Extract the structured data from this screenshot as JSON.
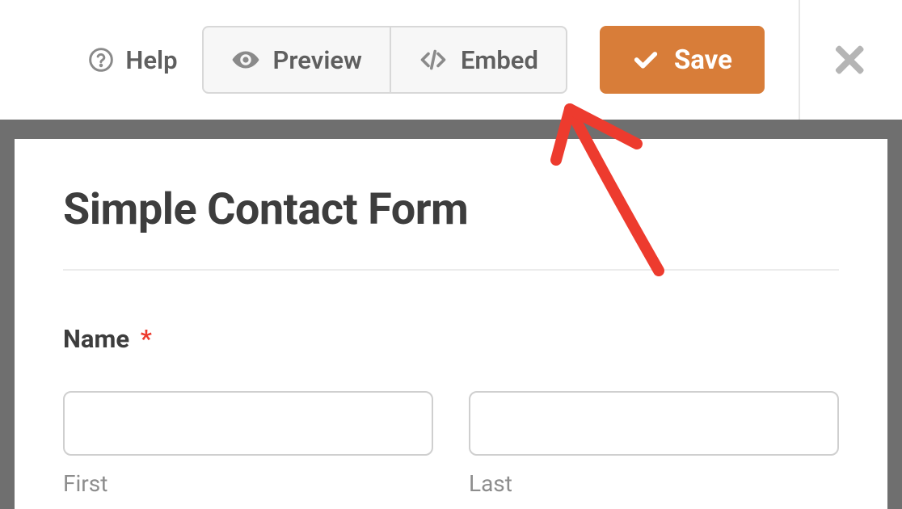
{
  "toolbar": {
    "help_label": "Help",
    "preview_label": "Preview",
    "embed_label": "Embed",
    "save_label": "Save"
  },
  "form": {
    "title": "Simple Contact Form",
    "name_label": "Name",
    "required_mark": "*",
    "first_sublabel": "First",
    "last_sublabel": "Last"
  },
  "colors": {
    "accent": "#d87d39",
    "required": "#ed3b2e",
    "annotation": "#ed3b2e"
  }
}
